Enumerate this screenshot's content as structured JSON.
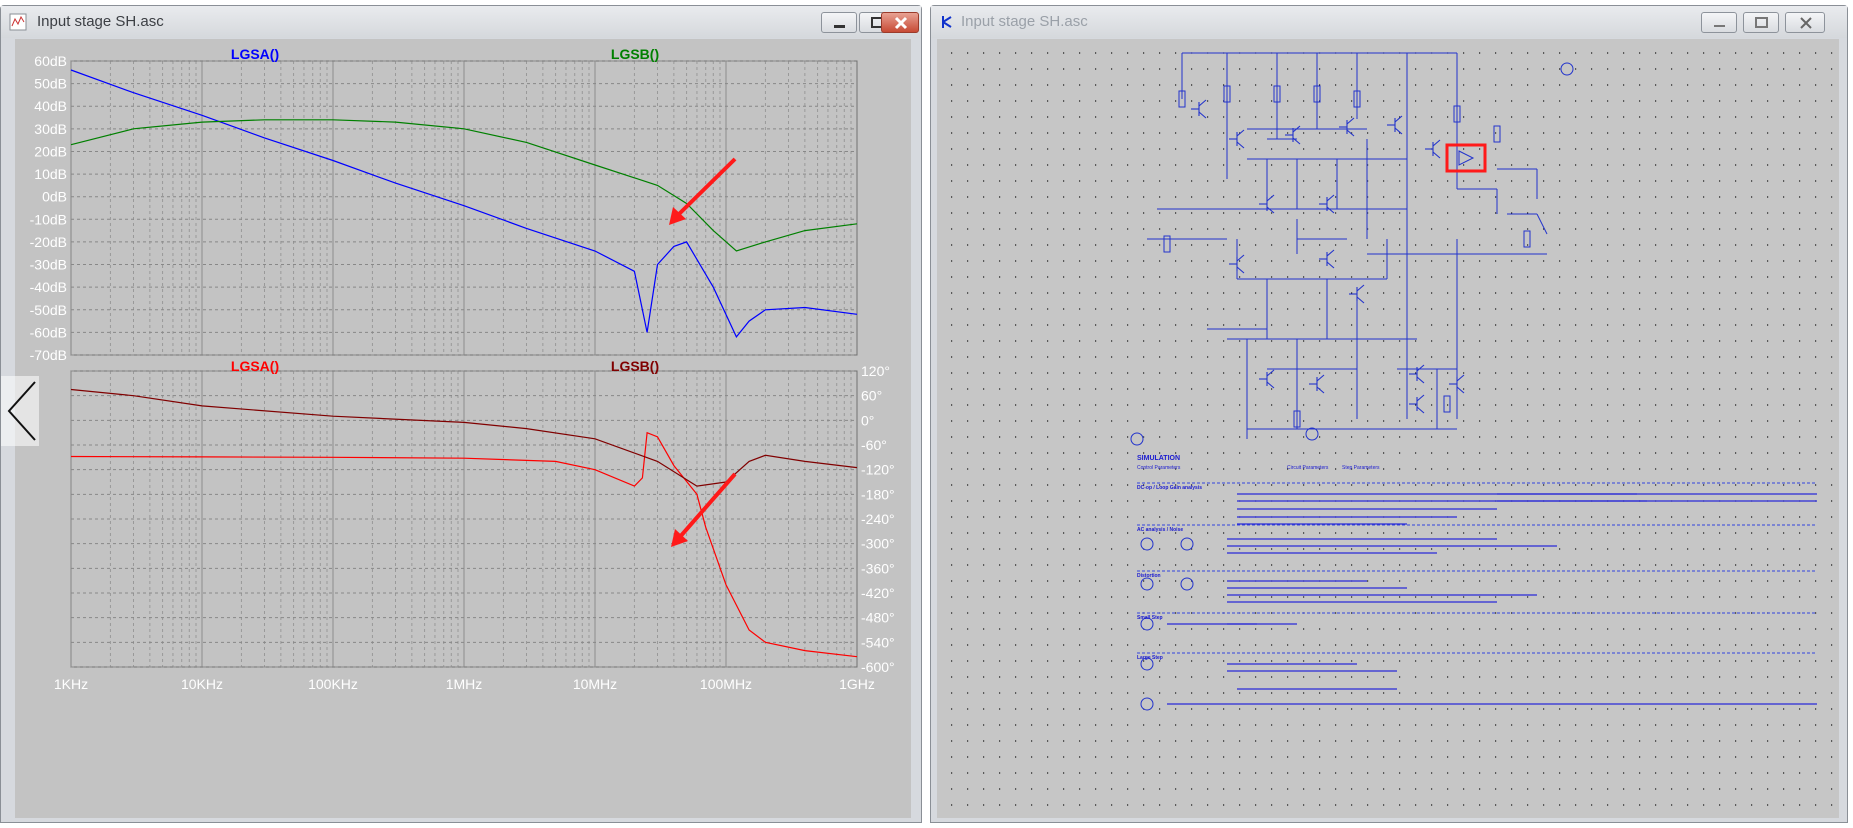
{
  "left_window": {
    "title": "Input stage SH.asc",
    "icon": "waveform-file-icon"
  },
  "right_window": {
    "title": "Input stage SH.asc",
    "icon": "schematic-file-icon"
  },
  "window_buttons": [
    "minimize",
    "maximize",
    "close"
  ],
  "chart_data": [
    {
      "type": "line",
      "panel": "magnitude",
      "series": [
        {
          "name": "LGSA()",
          "color": "#0000ff",
          "x": [
            1000,
            3000,
            10000,
            30000,
            100000,
            300000,
            1000000,
            3000000,
            10000000,
            20000000,
            25000000,
            30000000,
            40000000,
            50000000,
            80000000,
            120000000,
            150000000,
            200000000,
            400000000,
            1000000000
          ],
          "y": [
            56,
            46,
            36,
            26,
            16,
            6,
            -4,
            -14,
            -24,
            -33,
            -60,
            -30,
            -22,
            -20,
            -40,
            -62,
            -55,
            -50,
            -49,
            -52
          ]
        },
        {
          "name": "LGSB()",
          "color": "#008000",
          "x": [
            1000,
            3000,
            10000,
            30000,
            100000,
            300000,
            1000000,
            3000000,
            10000000,
            30000000,
            50000000,
            80000000,
            120000000,
            200000000,
            400000000,
            1000000000
          ],
          "y": [
            23,
            30,
            33,
            34,
            34,
            33,
            30,
            24,
            14,
            5,
            -3,
            -15,
            -24,
            -20,
            -15,
            -12
          ]
        }
      ],
      "y_axis": {
        "label_unit": "dB",
        "ticks": [
          "60dB",
          "50dB",
          "40dB",
          "30dB",
          "20dB",
          "10dB",
          "0dB",
          "-10dB",
          "-20dB",
          "-30dB",
          "-40dB",
          "-50dB",
          "-60dB",
          "-70dB"
        ],
        "range": [
          -70,
          60
        ]
      },
      "x_scale": "log",
      "grid": true
    },
    {
      "type": "line",
      "panel": "phase",
      "series": [
        {
          "name": "LGSA()",
          "color": "#ff0000",
          "x": [
            1000,
            10000,
            100000,
            1000000,
            5000000,
            10000000,
            20000000,
            23000000,
            25000000,
            30000000,
            40000000,
            60000000,
            70000000,
            100000000,
            150000000,
            200000000,
            400000000,
            1000000000
          ],
          "y": [
            -88,
            -89,
            -90,
            -92,
            -100,
            -120,
            -160,
            -140,
            -30,
            -40,
            -110,
            -180,
            -260,
            -400,
            -510,
            -540,
            -560,
            -575
          ]
        },
        {
          "name": "LGSB()",
          "color": "#800000",
          "x": [
            1000,
            3000,
            10000,
            100000,
            1000000,
            3000000,
            10000000,
            30000000,
            60000000,
            100000000,
            150000000,
            200000000,
            400000000,
            1000000000
          ],
          "y": [
            75,
            60,
            35,
            10,
            -5,
            -20,
            -45,
            -100,
            -160,
            -150,
            -100,
            -85,
            -100,
            -115
          ]
        }
      ],
      "y_axis": {
        "label_unit": "°",
        "ticks": [
          "120°",
          "60°",
          "0°",
          "-60°",
          "-120°",
          "-180°",
          "-240°",
          "-300°",
          "-360°",
          "-420°",
          "-480°",
          "-540°",
          "-600°"
        ],
        "range": [
          -600,
          120
        ]
      },
      "x_axis": {
        "ticks": [
          "1KHz",
          "10KHz",
          "100KHz",
          "1MHz",
          "10MHz",
          "100MHz",
          "1GHz"
        ],
        "range": [
          1000,
          1000000000
        ],
        "scale": "log"
      },
      "grid": true
    }
  ],
  "schematic": {
    "sim_header": "SIMULATION",
    "sub_headers": [
      "Control Parameters",
      "Circuit Parameters",
      "Step Parameters"
    ],
    "sections": [
      "DC-op / Loop Gain analysis",
      "AC analysis / Noise",
      "Distortion",
      "Small Step",
      "Large Step"
    ]
  },
  "annotation_color": "#ff1a1a"
}
